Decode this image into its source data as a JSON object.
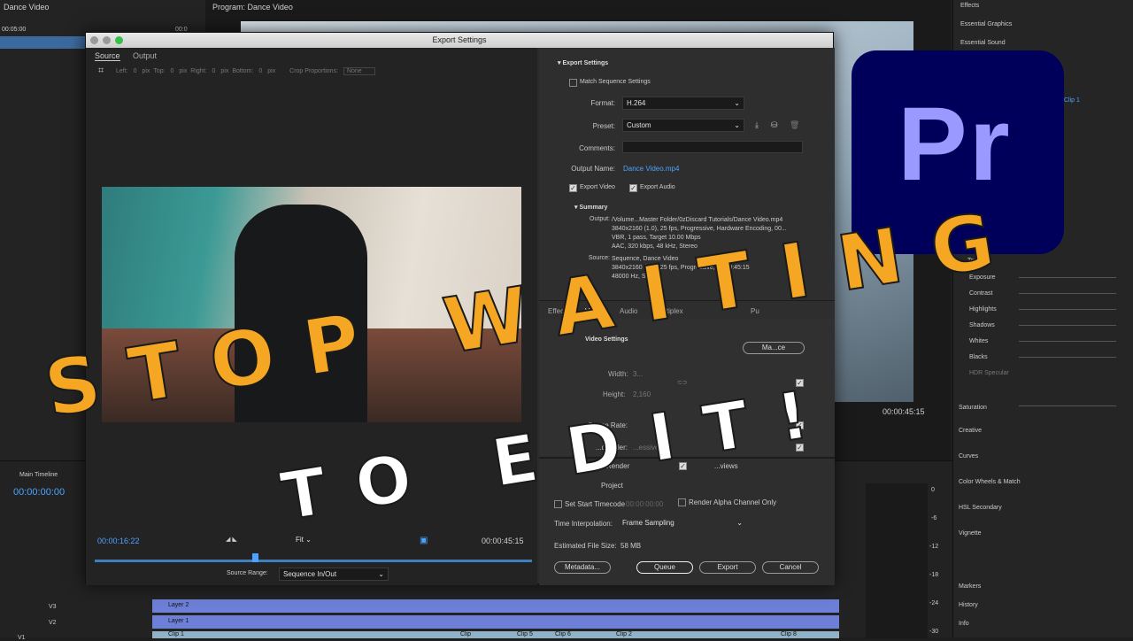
{
  "background": {
    "source_panel_title": "Dance Video",
    "source_tc_left": "00:05:00",
    "source_tc_right": "00:0",
    "program_title": "Program: Dance Video",
    "program_tc": "00:00:45:15",
    "right_panel": [
      "Effects",
      "Essential Graphics",
      "Essential Sound"
    ],
    "clip_ref": "Clip 1",
    "tone_label": "Tone",
    "tone_items": [
      "Exposure",
      "Contrast",
      "Highlights",
      "Shadows",
      "Whites",
      "Blacks",
      "HDR Specular"
    ],
    "saturation": "Saturation",
    "sections": [
      "Creative",
      "Curves",
      "Color Wheels & Match",
      "HSL Secondary",
      "Vignette"
    ],
    "bottom_right": [
      "Markers",
      "History",
      "Info"
    ],
    "timeline_title": "Main Timeline",
    "timeline_tc": "00:00:00:00",
    "tracks": [
      "V3",
      "V2",
      "V1"
    ],
    "layers": [
      "Layer 2",
      "Layer 1"
    ],
    "clips": [
      "Clip 1",
      "Clip",
      "Clip 5",
      "Clip 6",
      "Clip 2",
      "Clip 8"
    ],
    "meter_ticks": [
      "0",
      "-6",
      "-12",
      "-18",
      "-24",
      "-30"
    ]
  },
  "dialog": {
    "title": "Export Settings",
    "tabs": [
      "Source",
      "Output"
    ],
    "crop": {
      "left_label": "Left:",
      "left": "0",
      "unit": "pix",
      "top_label": "Top:",
      "top": "0",
      "right_label": "Right:",
      "right": "0",
      "bottom_label": "Bottom:",
      "bottom": "0",
      "proportions_label": "Crop Proportions:",
      "proportions": "None"
    },
    "current_tc": "00:00:16:22",
    "end_tc": "00:00:45:15",
    "fit": "Fit",
    "source_range_label": "Source Range:",
    "source_range": "Sequence In/Out",
    "export_settings": {
      "header": "Export Settings",
      "match_seq": "Match Sequence Settings",
      "format_label": "Format:",
      "format": "H.264",
      "preset_label": "Preset:",
      "preset": "Custom",
      "comments_label": "Comments:",
      "output_name_label": "Output Name:",
      "output_name": "Dance Video.mp4",
      "export_video": "Export Video",
      "export_audio": "Export Audio"
    },
    "summary": {
      "header": "Summary",
      "output_label": "Output:",
      "output_lines": [
        "/Volume...Master Folder/0zDiscard Tutorials/Dance Video.mp4",
        "3840x2160 (1.0), 25 fps, Progressive, Hardware Encoding, 00...",
        "VBR, 1 pass, Target 10.00 Mbps",
        "AAC, 320 kbps, 48 kHz, Stereo"
      ],
      "source_label": "Source:",
      "source_lines": [
        "Sequence, Dance Video",
        "3840x2160 (1.0), 25 fps, Progressive, 00:00:45:15",
        "48000 Hz, Stereo"
      ]
    },
    "settings_tabs": [
      "Effects",
      "Video",
      "Audio",
      "Multiplex",
      "Pu"
    ],
    "video_settings": {
      "header": "Video Settings",
      "match_btn": "Ma...ce",
      "width_label": "Width:",
      "width": "3...",
      "height_label": "Height:",
      "height": "2,160",
      "frame_rate_label": "Frame Rate:",
      "field_order_label": "...d Order:",
      "field_order": "...essive"
    },
    "options": {
      "render": "Render",
      "previews": "...views",
      "project": "Project",
      "start_tc_label": "Set Start Timecode",
      "start_tc": "00:00:00:00",
      "alpha": "Render Alpha Channel Only"
    },
    "interp_label": "Time Interpolation:",
    "interp": "Frame Sampling",
    "file_size_label": "Estimated File Size:",
    "file_size": "58 MB",
    "buttons": {
      "metadata": "Metadata...",
      "queue": "Queue",
      "export": "Export",
      "cancel": "Cancel"
    }
  },
  "overlay": {
    "line1": "STOP WAITING",
    "line2": "TO EDIT!",
    "logo": "Pr",
    "line1_color": "#f5a623",
    "line2_color": "#ffffff"
  }
}
